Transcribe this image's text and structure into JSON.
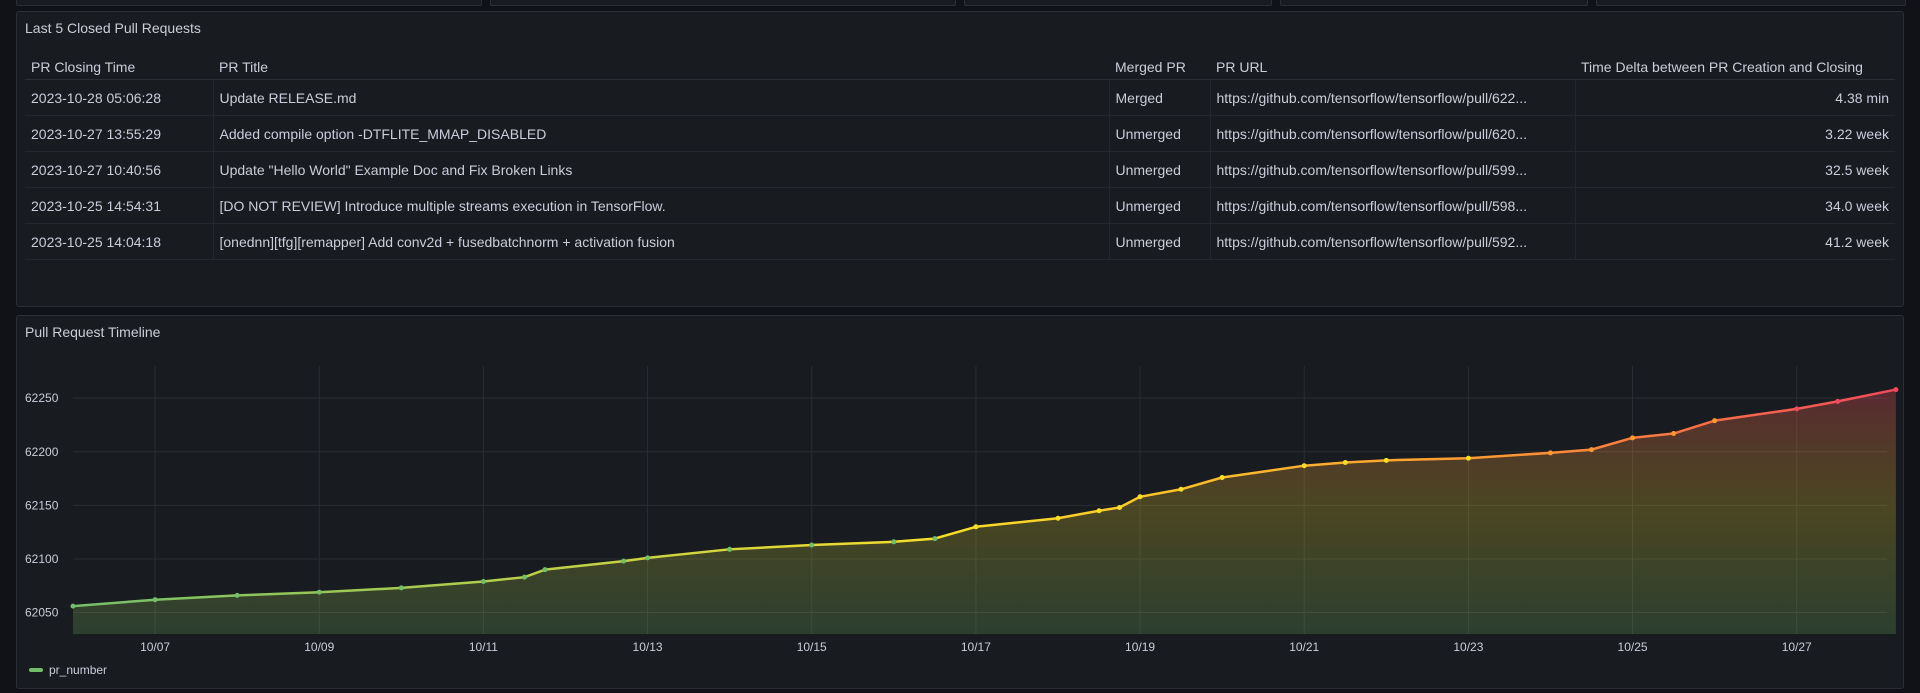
{
  "table_panel": {
    "title": "Last 5 Closed Pull Requests",
    "columns": [
      "PR Closing Time",
      "PR Title",
      "Merged PR",
      "PR URL",
      "Time Delta between PR Creation and Closing"
    ],
    "rows": [
      [
        "2023-10-28 05:06:28",
        "Update RELEASE.md",
        "Merged",
        "https://github.com/tensorflow/tensorflow/pull/622...",
        "4.38 min"
      ],
      [
        "2023-10-27 13:55:29",
        "Added compile option -DTFLITE_MMAP_DISABLED",
        "Unmerged",
        "https://github.com/tensorflow/tensorflow/pull/620...",
        "3.22 week"
      ],
      [
        "2023-10-27 10:40:56",
        "Update \"Hello World\" Example Doc and Fix Broken Links",
        "Unmerged",
        "https://github.com/tensorflow/tensorflow/pull/599...",
        "32.5 week"
      ],
      [
        "2023-10-25 14:54:31",
        "[DO NOT REVIEW] Introduce multiple streams execution in TensorFlow.",
        "Unmerged",
        "https://github.com/tensorflow/tensorflow/pull/598...",
        "34.0 week"
      ],
      [
        "2023-10-25 14:04:18",
        "[onednn][tfg][remapper] Add conv2d + fusedbatchnorm + activation fusion",
        "Unmerged",
        "https://github.com/tensorflow/tensorflow/pull/592...",
        "41.2 week"
      ]
    ]
  },
  "timeline_panel": {
    "title": "Pull Request Timeline",
    "legend": "pr_number"
  },
  "chart_data": {
    "type": "line",
    "title": "Pull Request Timeline",
    "xlabel": "",
    "ylabel": "",
    "x_tick_labels": [
      "10/07",
      "10/09",
      "10/11",
      "10/13",
      "10/15",
      "10/17",
      "10/19",
      "10/21",
      "10/23",
      "10/25",
      "10/27"
    ],
    "y_tick_labels": [
      "62050",
      "62100",
      "62150",
      "62200",
      "62250"
    ],
    "xlim_days_from_oct_6": [
      0,
      22.1
    ],
    "ylim": [
      62030,
      62280
    ],
    "grid": true,
    "legend_position": "bottom-left",
    "series": [
      {
        "name": "pr_number",
        "points": [
          [
            "10/06",
            62056
          ],
          [
            "10/07",
            62062
          ],
          [
            "10/08",
            62066
          ],
          [
            "10/09",
            62069
          ],
          [
            "10/10",
            62073
          ],
          [
            "10/11",
            62079
          ],
          [
            "10/11 12:00",
            62083
          ],
          [
            "10/11 18:00",
            62090
          ],
          [
            "10/12 17:00",
            62098
          ],
          [
            "10/13",
            62101
          ],
          [
            "10/14",
            62109
          ],
          [
            "10/15",
            62113
          ],
          [
            "10/16",
            62116
          ],
          [
            "10/16 12:00",
            62119
          ],
          [
            "10/17",
            62130
          ],
          [
            "10/18",
            62138
          ],
          [
            "10/18 12:00",
            62145
          ],
          [
            "10/18 18:00",
            62148
          ],
          [
            "10/19",
            62158
          ],
          [
            "10/19 12:00",
            62165
          ],
          [
            "10/20",
            62176
          ],
          [
            "10/21",
            62187
          ],
          [
            "10/21 12:00",
            62190
          ],
          [
            "10/22",
            62192
          ],
          [
            "10/23",
            62194
          ],
          [
            "10/24",
            62199
          ],
          [
            "10/24 12:00",
            62202
          ],
          [
            "10/25",
            62213
          ],
          [
            "10/25 12:00",
            62217
          ],
          [
            "10/26",
            62229
          ],
          [
            "10/27",
            62240
          ],
          [
            "10/27 12:00",
            62247
          ],
          [
            "10/28 05:00",
            62258
          ]
        ]
      }
    ],
    "colors": {
      "low": "#73bf69",
      "mid": "#fade2a",
      "high": "#f2495c"
    }
  }
}
